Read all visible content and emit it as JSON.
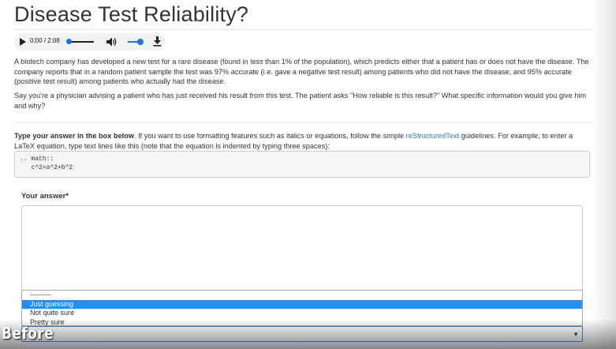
{
  "page": {
    "title": "Disease Test Reliability?"
  },
  "audio": {
    "time": "0:00 / 2:08"
  },
  "prompt": {
    "paragraph1": "A biotech company has developed a new test for a rare disease (found in less than 1% of the population), which predicts either that a patient has or does not have the disease. The company reports that in a random patient sample the test was 97% accurate (i.e. gave a negative test result) among patients who did not have the disease, and 95% accurate (positive test result) among patients who actually had the disease.",
    "paragraph2": "Say you're a physician advising a patient who has just received his result from this test. The patient asks \"How reliable is this result?\" What specific information would you give him and why?"
  },
  "instructions": {
    "bold": "Type your answer in the box below",
    "text1": ". If you want to use formatting features such as italics or equations, follow the simple ",
    "link": "reStructuredText",
    "text2": " guidelines. For example, to enter a LaTeX equation, type text lines like this (note that the equation is indented by typing three spaces):"
  },
  "code_example": ".. math::\n   c^2=a^2+b^2",
  "answer": {
    "label": "Your answer*",
    "value": ""
  },
  "confidence": {
    "options": [
      "---------",
      "Just guessing",
      "Not quite sure",
      "Pretty sure"
    ],
    "highlighted": "Just guessing"
  },
  "overlay": {
    "label": "Before"
  }
}
